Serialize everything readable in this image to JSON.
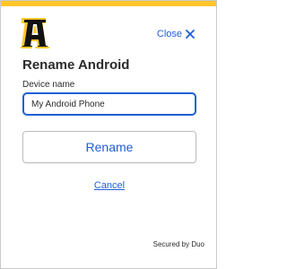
{
  "header": {
    "accent_color": "#ffc72c",
    "logo": "appalachian-state-a-logo",
    "close_label": "Close",
    "close_icon": "close-icon"
  },
  "form": {
    "title": "Rename Android",
    "field_label": "Device name",
    "device_name_value": "My Android Phone",
    "rename_label": "Rename",
    "cancel_label": "Cancel"
  },
  "footer": {
    "secured_text": "Secured by Duo"
  },
  "colors": {
    "link_blue": "#1f5fd6",
    "text": "#2b2b2b",
    "logo_black": "#111111",
    "logo_gold": "#ffc72c"
  }
}
